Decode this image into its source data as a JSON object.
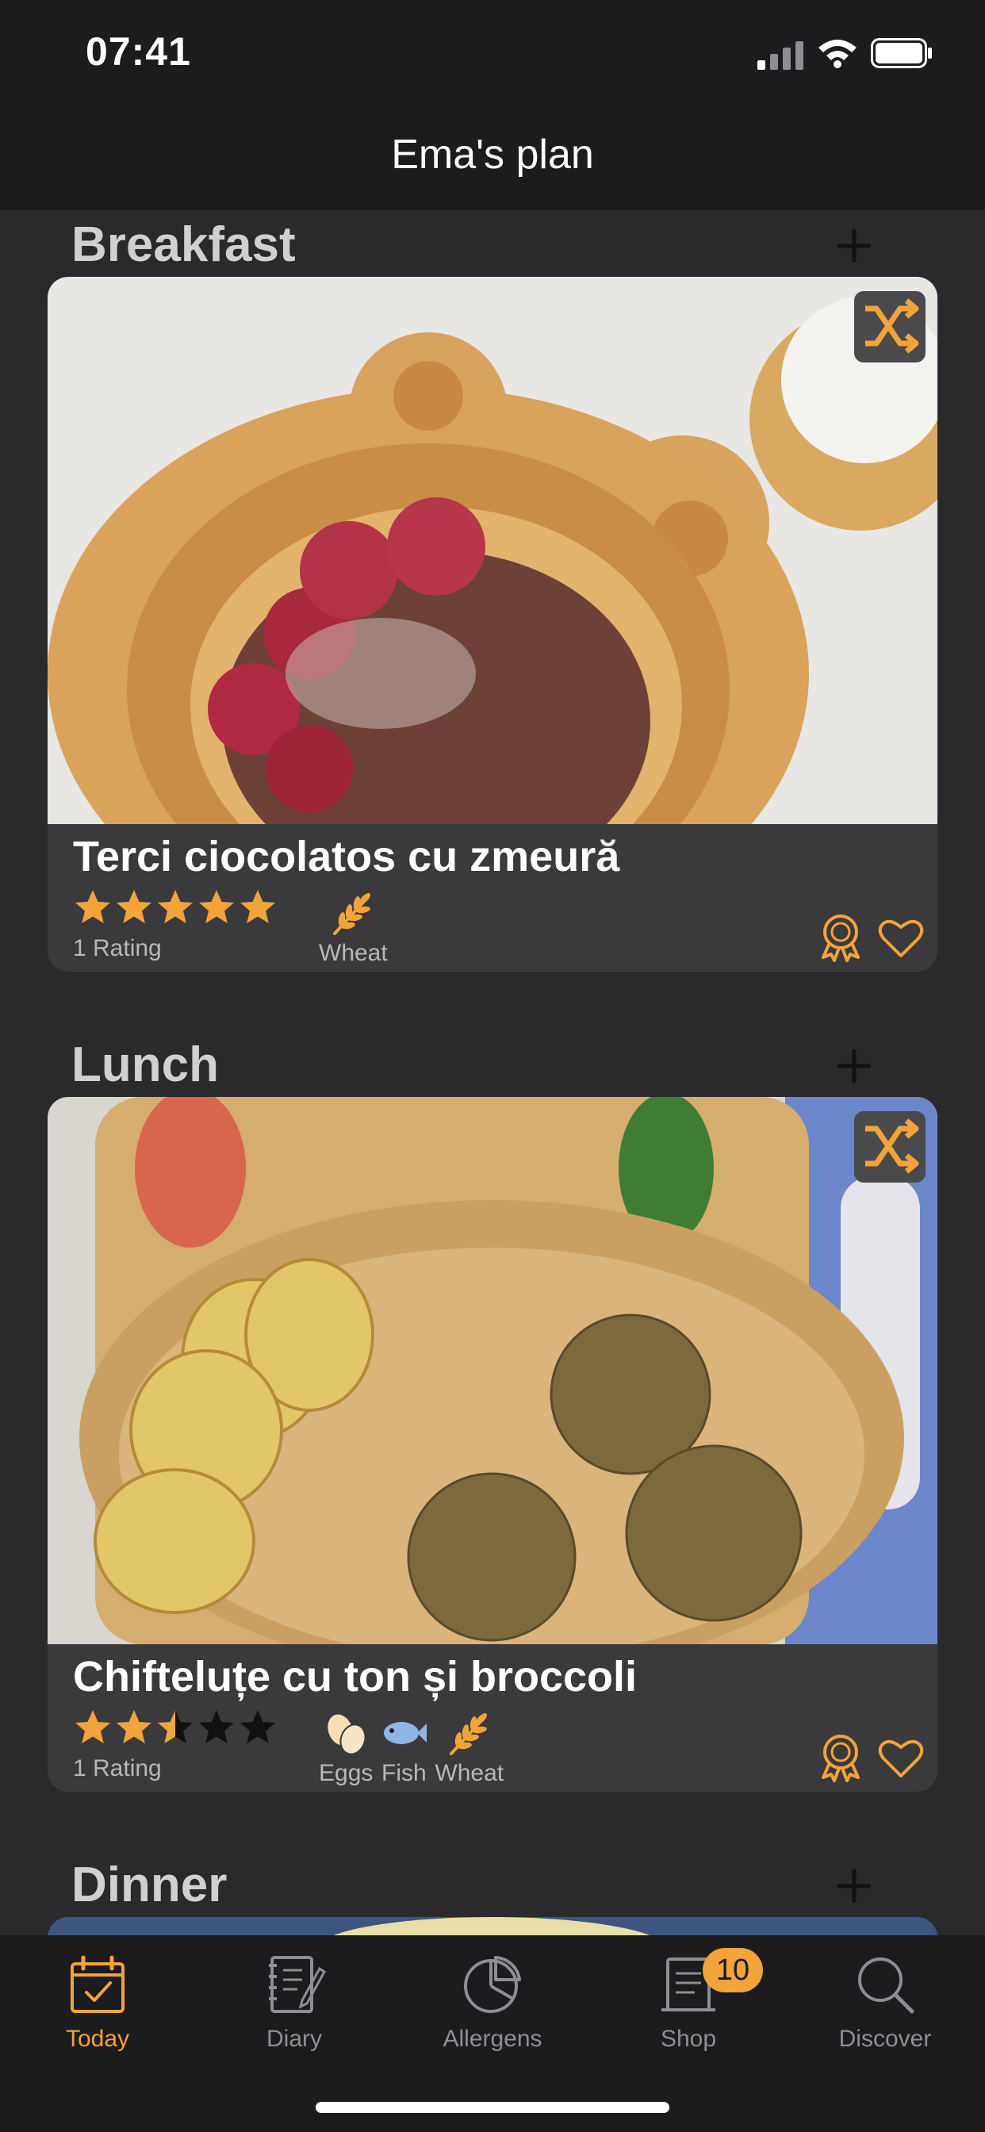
{
  "status_bar": {
    "time": "07:41"
  },
  "nav": {
    "title": "Ema's plan"
  },
  "colors": {
    "accent": "#f2a33a",
    "background": "#1c1c1e",
    "card": "#3a3a3c"
  },
  "sections": [
    {
      "title": "Breakfast",
      "recipe": {
        "title": "Terci ciocolatos cu zmeură",
        "rating": 5,
        "rating_text": "1 Rating",
        "allergens": [
          {
            "label": "Wheat",
            "icon": "wheat-icon"
          }
        ]
      }
    },
    {
      "title": "Lunch",
      "recipe": {
        "title": "Chifteluțe cu ton și broccoli",
        "rating": 2.5,
        "rating_text": "1 Rating",
        "allergens": [
          {
            "label": "Eggs",
            "icon": "eggs-icon"
          },
          {
            "label": "Fish",
            "icon": "fish-icon"
          },
          {
            "label": "Wheat",
            "icon": "wheat-icon"
          }
        ]
      }
    },
    {
      "title": "Dinner"
    }
  ],
  "tabs": [
    {
      "label": "Today",
      "icon": "calendar-check-icon",
      "active": true
    },
    {
      "label": "Diary",
      "icon": "diary-icon"
    },
    {
      "label": "Allergens",
      "icon": "pie-chart-icon"
    },
    {
      "label": "Shop",
      "icon": "shopping-list-icon",
      "badge": "10"
    },
    {
      "label": "Discover",
      "icon": "search-icon"
    }
  ]
}
